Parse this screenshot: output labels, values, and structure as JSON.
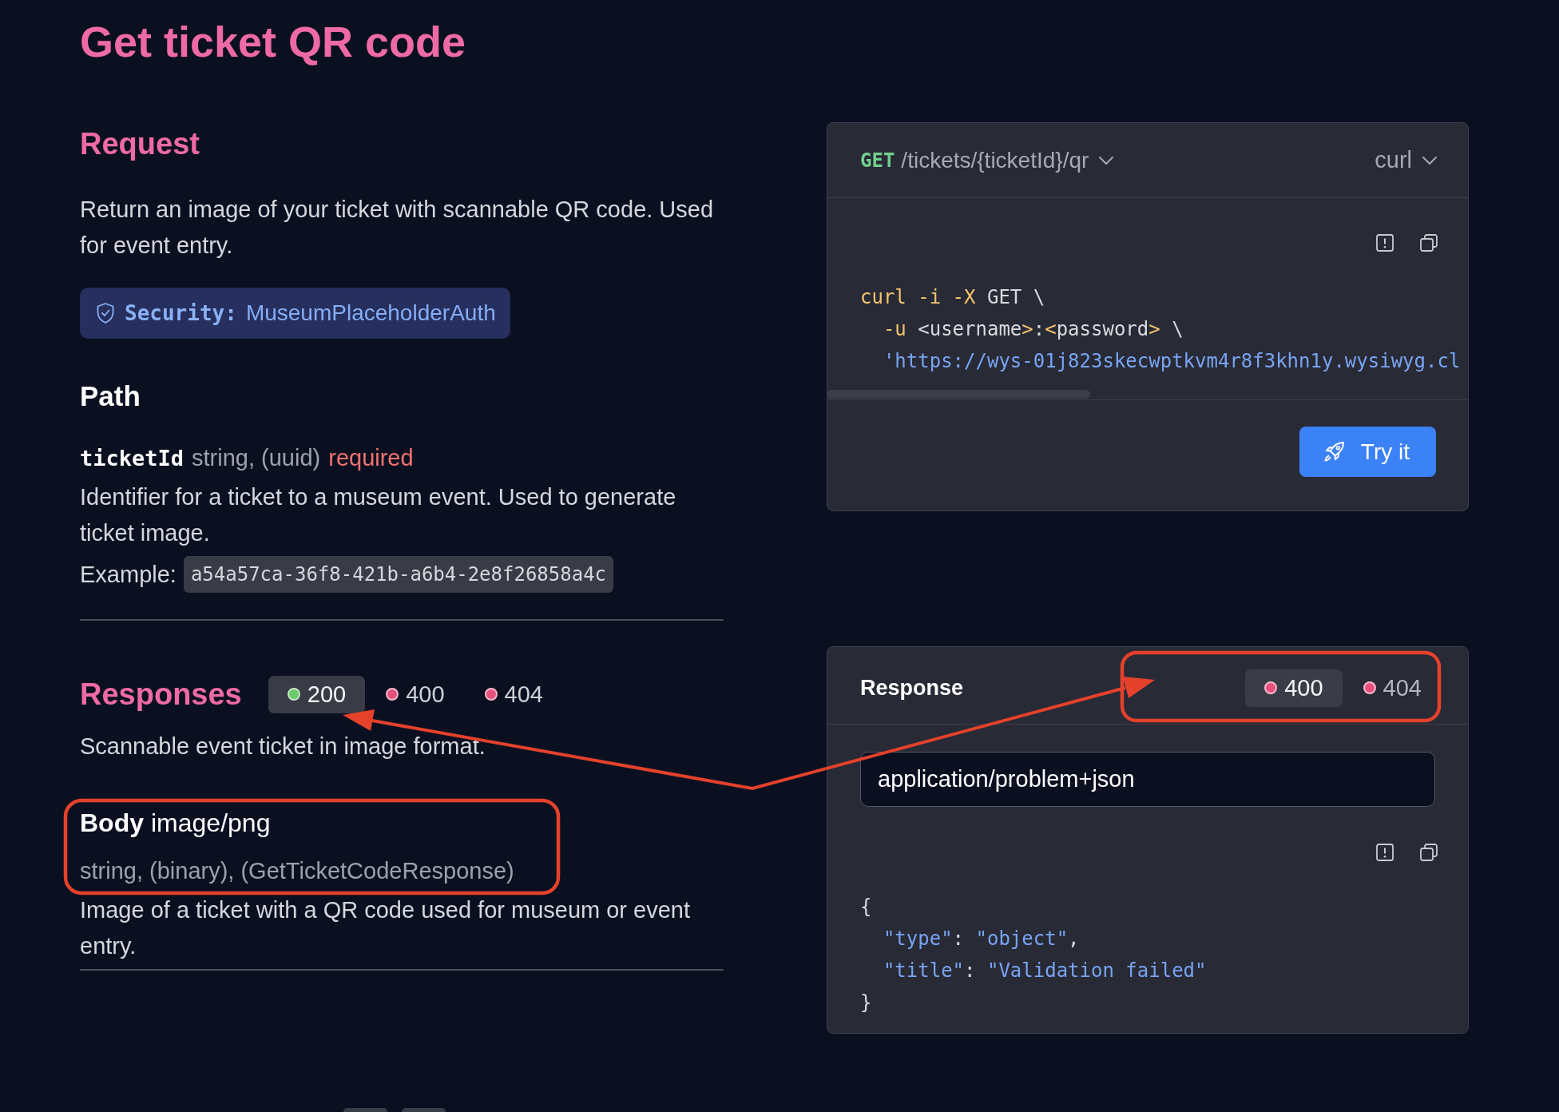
{
  "title": "Get ticket QR code",
  "request": {
    "heading": "Request",
    "description": "Return an image of your ticket with scannable QR code. Used for event entry.",
    "security": {
      "label": "Security:",
      "value": "MuseumPlaceholderAuth"
    }
  },
  "path": {
    "heading": "Path",
    "params": [
      {
        "name": "ticketId",
        "type": "string, (uuid)",
        "requirement": "required",
        "description": "Identifier for a ticket to a museum event. Used to generate ticket image.",
        "example_label": "Example:",
        "example": "a54a57ca-36f8-421b-a6b4-2e8f26858a4c"
      }
    ]
  },
  "responses": {
    "heading": "Responses",
    "tabs": [
      {
        "label": "200",
        "color": "#6cc96c",
        "selected": true
      },
      {
        "label": "400",
        "color": "#e8517e",
        "selected": false
      },
      {
        "label": "404",
        "color": "#e8517e",
        "selected": false
      }
    ],
    "description": "Scannable event ticket in image format.",
    "body": {
      "label": "Body",
      "media_type": "image/png",
      "schema": "string, (binary), (GetTicketCodeResponse)",
      "description": "Image of a ticket with a QR code used for museum or event entry."
    }
  },
  "request_panel": {
    "method": "GET",
    "path": "/tickets/{ticketId}/qr",
    "language": "curl",
    "code": [
      [
        {
          "kind": "flag",
          "text": "curl -i -X"
        },
        {
          "kind": "plain",
          "text": " GET \\"
        }
      ],
      [
        {
          "kind": "flag",
          "text": "  -u"
        },
        {
          "kind": "plain",
          "text": " <username"
        },
        {
          "kind": "flag",
          "text": ">"
        },
        {
          "kind": "plain",
          "text": ":"
        },
        {
          "kind": "flag",
          "text": "<"
        },
        {
          "kind": "plain",
          "text": "password"
        },
        {
          "kind": "flag",
          "text": ">"
        },
        {
          "kind": "plain",
          "text": " \\"
        }
      ],
      [
        {
          "kind": "string",
          "text": "  'https://wys-01j823skecwptkvm4r8f3khn1y.wysiwyg.cl"
        }
      ]
    ],
    "action": "Try it"
  },
  "response_panel": {
    "title": "Response",
    "tabs": [
      {
        "label": "400",
        "color": "#e8517e",
        "selected": true
      },
      {
        "label": "404",
        "color": "#e8517e",
        "selected": false
      }
    ],
    "content_type": "application/problem+json",
    "code": [
      [
        {
          "kind": "punct",
          "text": "{"
        }
      ],
      [
        {
          "kind": "key",
          "text": "  \"type\""
        },
        {
          "kind": "punct",
          "text": ": "
        },
        {
          "kind": "string",
          "text": "\"object\""
        },
        {
          "kind": "punct",
          "text": ","
        }
      ],
      [
        {
          "kind": "key",
          "text": "  \"title\""
        },
        {
          "kind": "punct",
          "text": ": "
        },
        {
          "kind": "string",
          "text": "\"Validation failed\""
        }
      ],
      [
        {
          "kind": "punct",
          "text": "}"
        }
      ]
    ]
  }
}
